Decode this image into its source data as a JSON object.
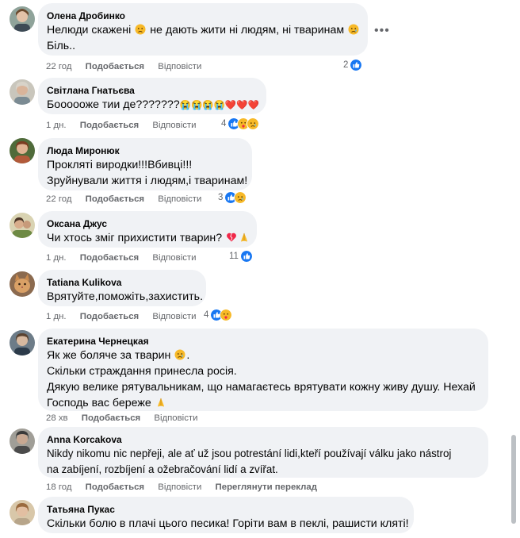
{
  "comments": [
    {
      "author": "Олена Дробинко",
      "line1": "Нелюди скажені",
      "line1b": "не дають жити ні людям, ні тваринам",
      "line2": "Біль..",
      "time": "22 год",
      "like": "Подобається",
      "reply": "Відповісти",
      "count": "2",
      "reactions": [
        "like-icon"
      ]
    },
    {
      "author": "Світлана Гнатьєва",
      "line1": "Боооооже тии де???????",
      "emoji_tail": "😭😭😭😭❤️❤️❤️",
      "time": "1 дн.",
      "like": "Подобається",
      "reply": "Відповісти",
      "count": "4",
      "reactions": [
        "like-icon",
        "care-icon",
        "sad-icon"
      ]
    },
    {
      "author": "Люда Миронюк",
      "line1": "Прокляті виродки!!!Вбивці!!!",
      "line2": "Зруйнували життя і людям,і тваринам!",
      "time": "22 год",
      "like": "Подобається",
      "reply": "Відповісти",
      "count": "3",
      "reactions": [
        "like-icon",
        "sad-icon"
      ]
    },
    {
      "author": "Оксана Джус",
      "line1": "Чи хтось зміг прихистити тварин?",
      "time": "1 дн.",
      "like": "Подобається",
      "reply": "Відповісти",
      "count": "11",
      "reactions": [
        "like-icon"
      ]
    },
    {
      "author": "Tatiana Kulikova",
      "line1": "Врятуйте,поможіть,захистить.",
      "time": "1 дн.",
      "like": "Подобається",
      "reply": "Відповісти",
      "count": "4",
      "reactions": [
        "like-icon",
        "care-icon"
      ]
    },
    {
      "author": "Екатерина Чернецкая",
      "line1": "Як же боляче за тварин",
      "line2": "Скільки страждання принесла росія.",
      "line3": "Дякую велике рятувальникам, що намагаєтесь врятувати кожну живу душу. Нехай",
      "line4": "Господь вас береже",
      "time": "28 хв",
      "like": "Подобається",
      "reply": "Відповісти"
    },
    {
      "author": "Anna Korcakova",
      "line1": "Nikdy nikomu nic nepřeji, ale ať už jsou potrestání lidi,kteří používají válku jako nástroj",
      "line2": "na zabíjení, rozbíjení a ožebračování lidí a zvířat.",
      "time": "18 год",
      "like": "Подобається",
      "reply": "Відповісти",
      "translate": "Переглянути переклад"
    },
    {
      "author": "Татьяна Пукас",
      "line1": "Скільки болю в плачі цього песика! Горіти вам в пеклі, рашисти кляті!"
    }
  ],
  "colors": {
    "bubble": "#f0f2f5",
    "meta": "#65676b",
    "like_blue": "#1877f2",
    "love_red": "#f02849",
    "emoji_yellow": "#f7b928"
  }
}
